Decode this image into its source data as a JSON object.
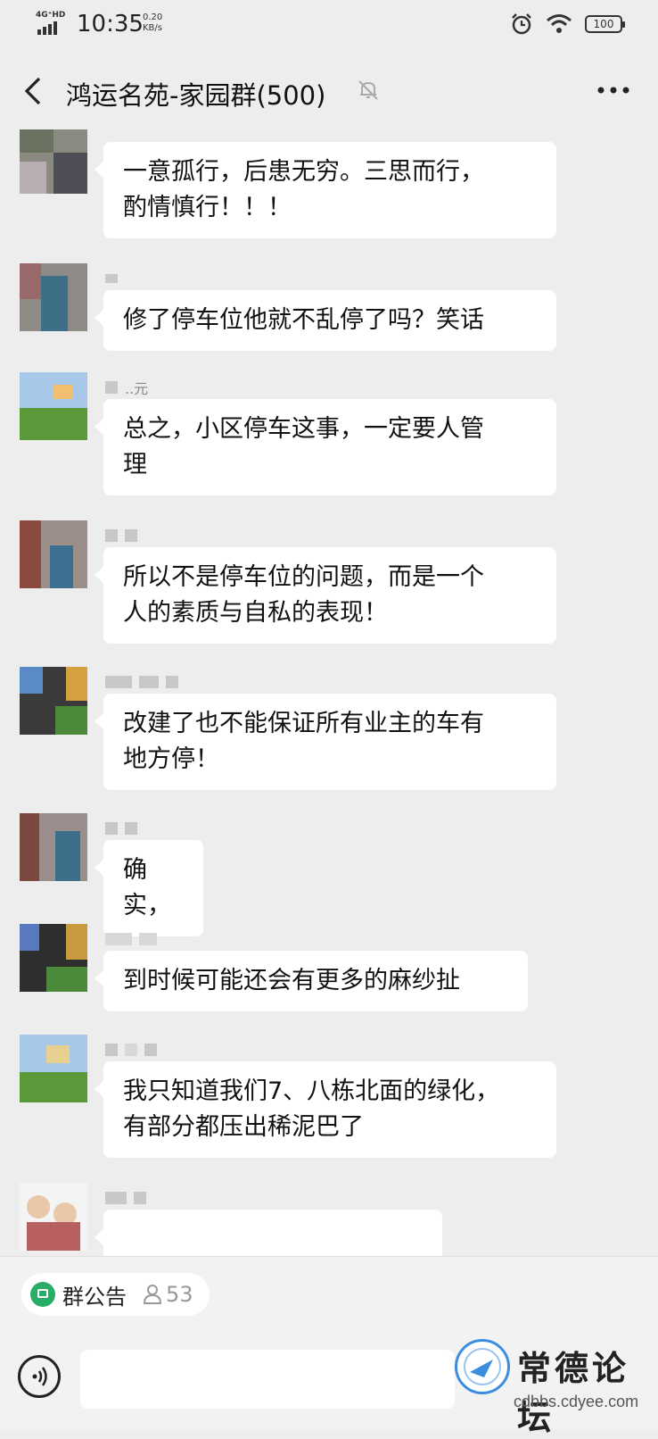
{
  "status_bar": {
    "network": "4G⁺HD",
    "time": "10:35",
    "speed_value": "0.20",
    "speed_unit": "KB/s",
    "battery": "100"
  },
  "header": {
    "title": "鸿运名苑-家园群(500)"
  },
  "messages": [
    {
      "sender": "",
      "text_lines": [
        "一意孤行，后患无穷。三思而行，",
        "酌情慎行！！！"
      ]
    },
    {
      "sender": "",
      "text_lines": [
        "修了停车位他就不乱停了吗？笑话"
      ]
    },
    {
      "sender": "..元",
      "text_lines": [
        "总之，小区停车这事，一定要人管",
        "理"
      ]
    },
    {
      "sender": "",
      "text_lines": [
        "所以不是停车位的问题，而是一个",
        "人的素质与自私的表现！"
      ]
    },
    {
      "sender": "",
      "text_lines": [
        "改建了也不能保证所有业主的车有",
        "地方停！"
      ]
    },
    {
      "sender": "",
      "text_lines": [
        "确实，"
      ]
    },
    {
      "sender": "",
      "text_lines": [
        "到时候可能还会有更多的麻纱扯"
      ]
    },
    {
      "sender": "",
      "text_lines": [
        "我只知道我们7、八栋北面的绿化，",
        "有部分都压出稀泥巴了"
      ]
    }
  ],
  "bottom": {
    "notice_label": "群公告",
    "member_count": "53"
  },
  "watermark": {
    "name": "常德论坛",
    "url": "cdbbs.cdyee.com"
  },
  "colors": {
    "background": "#ededed",
    "bubble": "#ffffff",
    "notice_icon": "#2aae67"
  }
}
